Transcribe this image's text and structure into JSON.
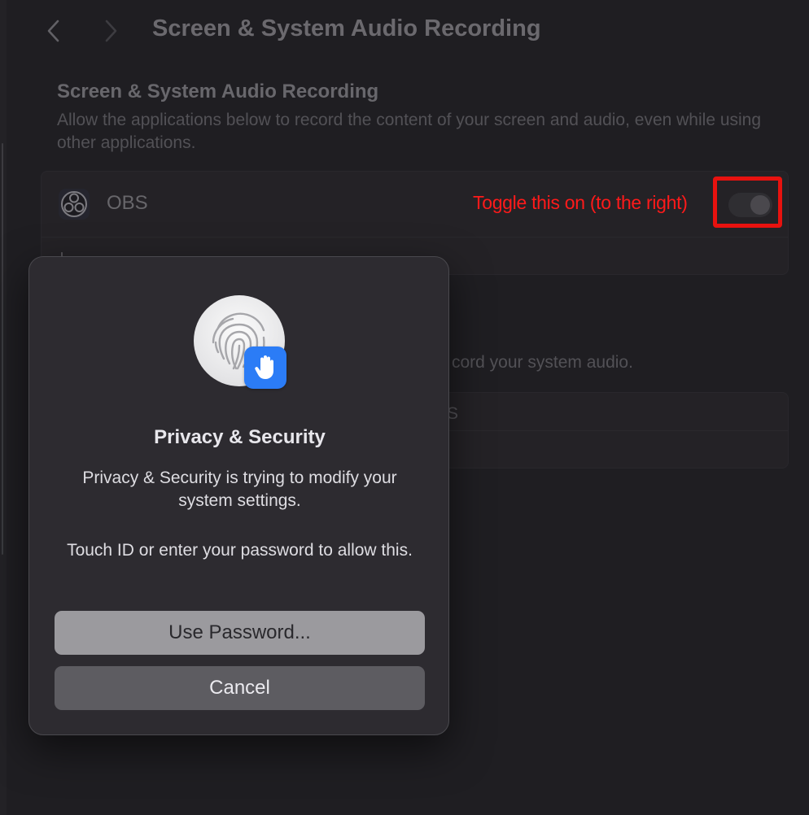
{
  "window": {
    "title": "Screen & System Audio Recording"
  },
  "section": {
    "title": "Screen & System Audio Recording",
    "description": "Allow the applications below to record the content of your screen and audio, even while using other applications."
  },
  "apps": [
    {
      "name": "OBS",
      "icon": "obs-icon",
      "enabled": false
    }
  ],
  "controls": {
    "add_symbol": "+"
  },
  "system_audio": {
    "description_fragment": "cord your system audio.",
    "row_fragment": "S"
  },
  "annotation": {
    "label": "Toggle this on (to the right)",
    "color": "#ff1a1a"
  },
  "dialog": {
    "title": "Privacy & Security",
    "message": "Privacy & Security is trying to modify your system settings.",
    "hint": "Touch ID or enter your password to allow this.",
    "buttons": {
      "use_password": "Use Password...",
      "cancel": "Cancel"
    },
    "icons": [
      "fingerprint-icon",
      "hand-icon"
    ]
  },
  "colors": {
    "accent": "#2b7cf6",
    "background": "#1f1e22",
    "dialog": "#2d2b30"
  }
}
